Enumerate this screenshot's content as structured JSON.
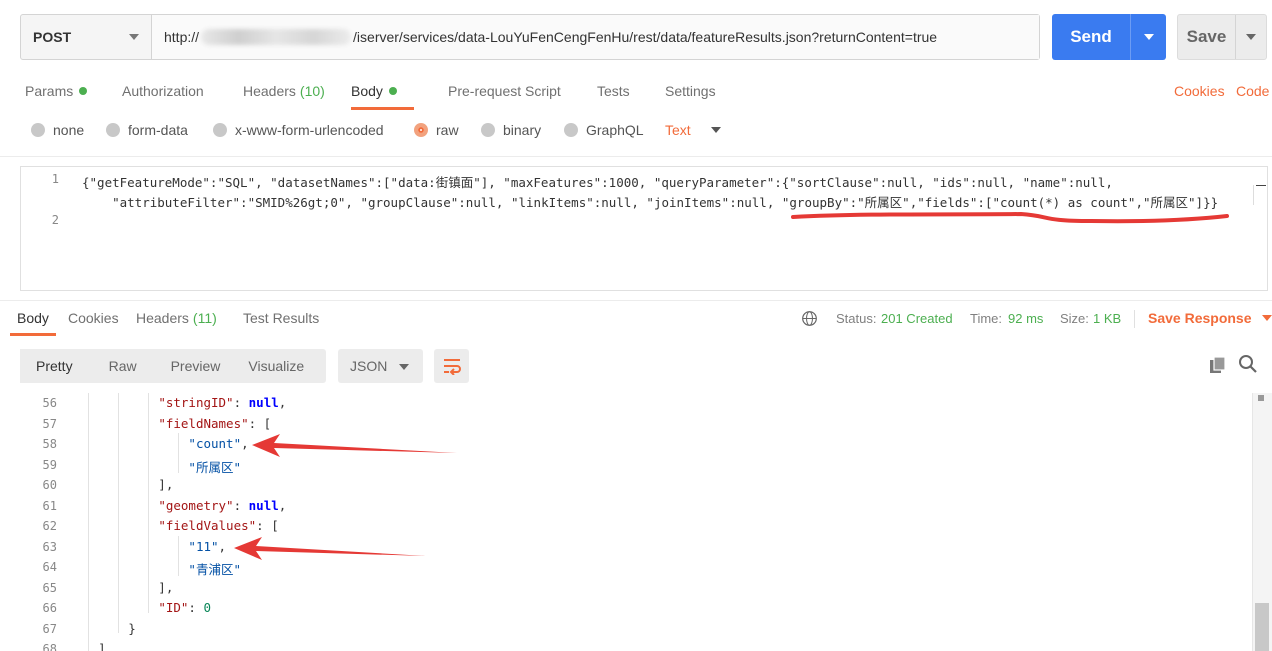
{
  "request": {
    "method": "POST",
    "url_prefix": "http://",
    "url_suffix": "/iserver/services/data-LouYuFenCengFenHu/rest/data/featureResults.json?returnContent=true",
    "send_label": "Send",
    "save_label": "Save"
  },
  "request_tabs": {
    "params": "Params",
    "authorization": "Authorization",
    "headers": "Headers",
    "headers_count": "(10)",
    "body": "Body",
    "pre_request": "Pre-request Script",
    "tests": "Tests",
    "settings": "Settings",
    "cookies": "Cookies",
    "code": "Code"
  },
  "body_types": {
    "none": "none",
    "form_data": "form-data",
    "urlencoded": "x-www-form-urlencoded",
    "raw": "raw",
    "binary": "binary",
    "graphql": "GraphQL",
    "selected": "raw",
    "text_type": "Text"
  },
  "editor": {
    "line_numbers": [
      "1",
      "2"
    ],
    "lines": [
      "{\"getFeatureMode\":\"SQL\", \"datasetNames\":[\"data:街镇面\"], \"maxFeatures\":1000, \"queryParameter\":{\"sortClause\":null, \"ids\":null, \"name\":null,",
      "    \"attributeFilter\":\"SMID%26gt;0\", \"groupClause\":null, \"linkItems\":null, \"joinItems\":null, \"groupBy\":\"所属区\",\"fields\":[\"count(*) as count\",\"所属区\"]}}",
      ""
    ]
  },
  "response_tabs": {
    "body": "Body",
    "cookies": "Cookies",
    "headers": "Headers",
    "headers_count": "(11)",
    "test_results": "Test Results"
  },
  "response_status": {
    "status_label": "Status:",
    "status_value": "201 Created",
    "time_label": "Time:",
    "time_value": "92 ms",
    "size_label": "Size:",
    "size_value": "1 KB",
    "save_response": "Save Response"
  },
  "view_modes": {
    "pretty": "Pretty",
    "raw": "Raw",
    "preview": "Preview",
    "visualize": "Visualize",
    "format": "JSON"
  },
  "response_lines": [
    {
      "num": "56",
      "text": "            \"stringID\": null,"
    },
    {
      "num": "57",
      "text": "            \"fieldNames\": ["
    },
    {
      "num": "58",
      "text": "                \"count\","
    },
    {
      "num": "59",
      "text": "                \"所属区\""
    },
    {
      "num": "60",
      "text": "            ],"
    },
    {
      "num": "61",
      "text": "            \"geometry\": null,"
    },
    {
      "num": "62",
      "text": "            \"fieldValues\": ["
    },
    {
      "num": "63",
      "text": "                \"11\","
    },
    {
      "num": "64",
      "text": "                \"青浦区\""
    },
    {
      "num": "65",
      "text": "            ],"
    },
    {
      "num": "66",
      "text": "            \"ID\": 0"
    },
    {
      "num": "67",
      "text": "        }"
    },
    {
      "num": "68",
      "text": "    ]"
    }
  ],
  "colors": {
    "accent": "#f26b3a",
    "send": "#3a7bf0",
    "status_ok": "#4caf50",
    "annotation": "#e53935"
  },
  "icons": {
    "globe": "globe-icon",
    "copy": "copy-icon",
    "search": "search-icon",
    "wrap": "wrap-lines-icon"
  }
}
